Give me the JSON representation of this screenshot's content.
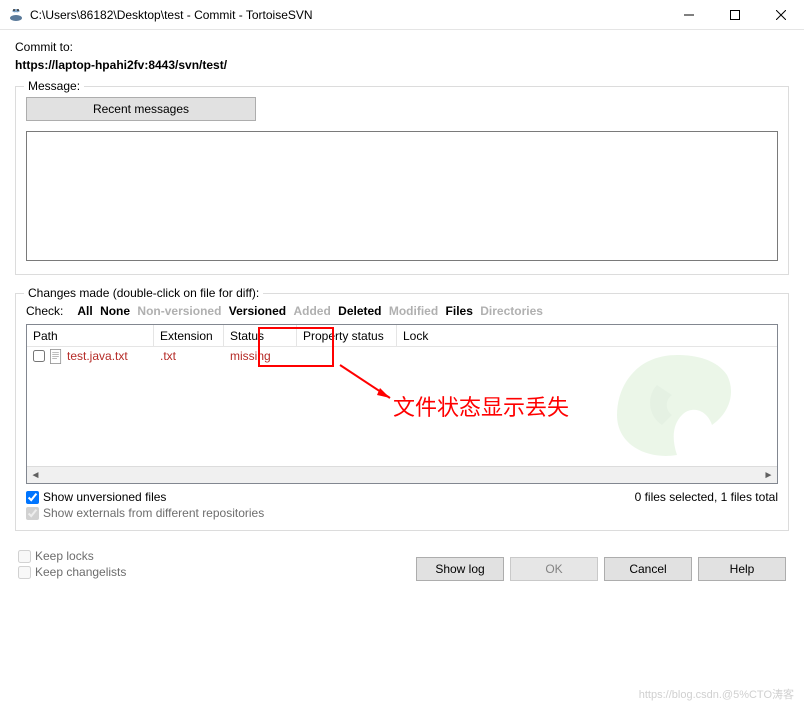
{
  "window": {
    "title": "C:\\Users\\86182\\Desktop\\test - Commit - TortoiseSVN"
  },
  "commit": {
    "label": "Commit to:",
    "url": "https://laptop-hpahi2fv:8443/svn/test/"
  },
  "message": {
    "legend": "Message:",
    "recent_btn": "Recent messages",
    "value": ""
  },
  "changes": {
    "legend": "Changes made (double-click on file for diff):",
    "check_label": "Check:",
    "filters": {
      "all": "All",
      "none": "None",
      "nonversioned": "Non-versioned",
      "versioned": "Versioned",
      "added": "Added",
      "deleted": "Deleted",
      "modified": "Modified",
      "files": "Files",
      "directories": "Directories"
    },
    "headers": {
      "path": "Path",
      "extension": "Extension",
      "status": "Status",
      "property_status": "Property status",
      "lock": "Lock"
    },
    "rows": [
      {
        "path": "test.java.txt",
        "extension": ".txt",
        "status": "missing",
        "property_status": "",
        "lock": ""
      }
    ],
    "annotation": "文件状态显示丢失",
    "show_unversioned": "Show unversioned files",
    "show_externals": "Show externals from different repositories",
    "count_text": "0 files selected, 1 files total"
  },
  "options": {
    "keep_locks": "Keep locks",
    "keep_changelists": "Keep changelists"
  },
  "buttons": {
    "show_log": "Show log",
    "ok": "OK",
    "cancel": "Cancel",
    "help": "Help"
  },
  "watermark": "https://blog.csdn.@5%CTO涛客"
}
